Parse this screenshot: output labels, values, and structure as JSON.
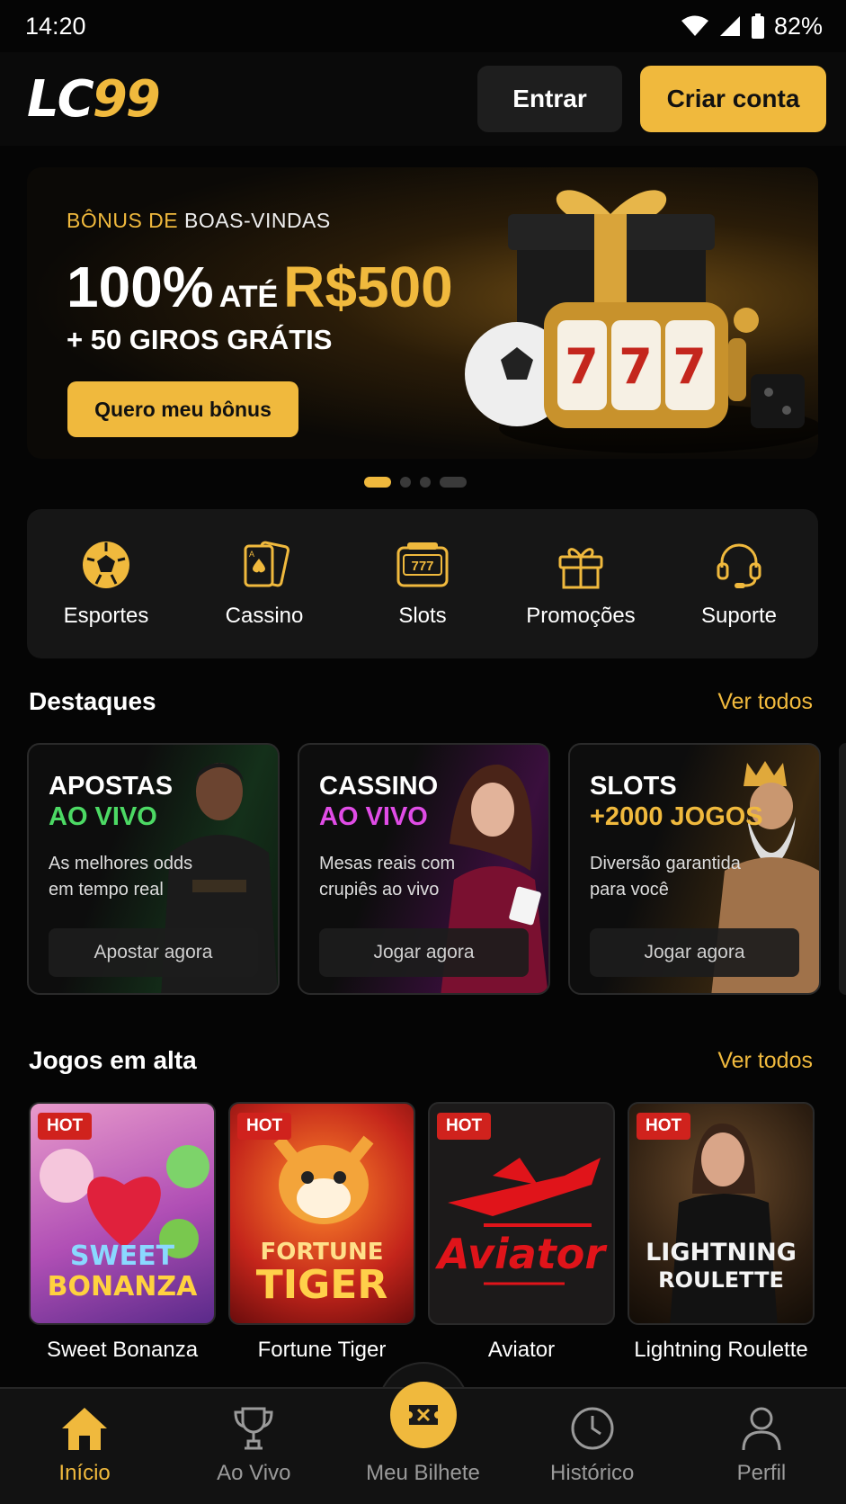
{
  "status_bar": {
    "time": "14:20",
    "battery": "82%"
  },
  "header": {
    "logo_left": "LC",
    "logo_right": "99",
    "login_label": "Entrar",
    "signup_label": "Criar conta"
  },
  "banner": {
    "kicker_gold": "BÔNUS DE",
    "kicker_white": "BOAS-VINDAS",
    "percent": "100%",
    "ate": "ATÉ",
    "amount": "R$500",
    "subtitle": "+ 50 GIROS GRÁTIS",
    "cta": "Quero meu bônus",
    "slides": 4,
    "active_slide": 1
  },
  "quick_nav": [
    {
      "label": "Esportes",
      "icon": "soccer-ball-icon"
    },
    {
      "label": "Cassino",
      "icon": "playing-cards-icon"
    },
    {
      "label": "Slots",
      "icon": "slot-machine-icon"
    },
    {
      "label": "Promoções",
      "icon": "gift-icon"
    },
    {
      "label": "Suporte",
      "icon": "headset-icon"
    }
  ],
  "highlights": {
    "title": "Destaques",
    "see_all": "Ver todos",
    "cards": [
      {
        "line1": "APOSTAS",
        "line2": "AO VIVO",
        "accent": "#4cd964",
        "desc": "As melhores odds em tempo real",
        "button": "Apostar agora"
      },
      {
        "line1": "CASSINO",
        "line2": "AO VIVO",
        "accent": "#e04ce6",
        "desc": "Mesas reais com crupiês ao vivo",
        "button": "Jogar agora"
      },
      {
        "line1": "SLOTS",
        "line2": "+2000 JOGOS",
        "accent": "#f0b93d",
        "desc": "Diversão garantida para você",
        "button": "Jogar agora"
      }
    ]
  },
  "trending": {
    "title": "Jogos em alta",
    "see_all": "Ver todos",
    "badge": "HOT",
    "games": [
      {
        "name": "Sweet Bonanza",
        "art_line1": "SWEET",
        "art_line2": "BONANZA"
      },
      {
        "name": "Fortune Tiger",
        "art_line1": "FORTUNE",
        "art_line2": "TIGER"
      },
      {
        "name": "Aviator",
        "art_line1": "Aviator",
        "art_line2": ""
      },
      {
        "name": "Lightning Roulette",
        "art_line1": "LIGHTNING",
        "art_line2": "ROULETTE"
      }
    ]
  },
  "tabbar": [
    {
      "label": "Início",
      "icon": "home-icon",
      "active": true
    },
    {
      "label": "Ao Vivo",
      "icon": "trophy-icon",
      "active": false
    },
    {
      "label": "Meu Bilhete",
      "icon": "ticket-icon",
      "active": false
    },
    {
      "label": "Histórico",
      "icon": "clock-icon",
      "active": false
    },
    {
      "label": "Perfil",
      "icon": "user-icon",
      "active": false
    }
  ],
  "colors": {
    "gold": "#f0b93d",
    "background": "#050505",
    "card": "#161616",
    "hot": "#d0221d"
  }
}
